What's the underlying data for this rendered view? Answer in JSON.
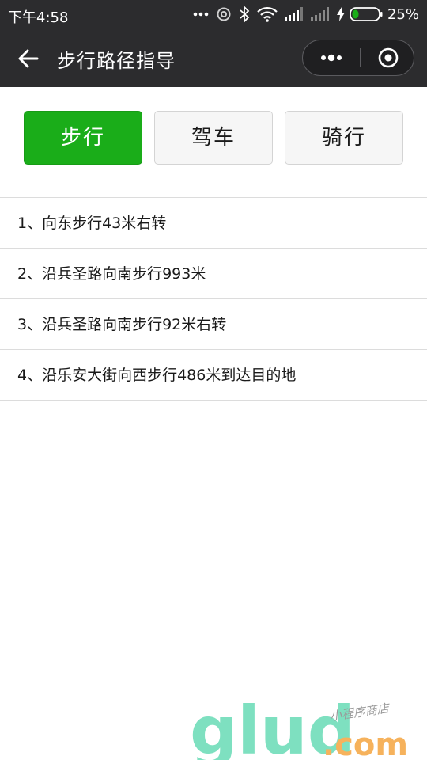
{
  "status_bar": {
    "time": "下午4:58",
    "battery_percent": "25%",
    "battery_level": 0.25,
    "icons": [
      "more-dots-icon",
      "signal-loop-icon",
      "bluetooth-icon",
      "wifi-icon",
      "cell-signal-icon",
      "cell-signal-icon",
      "charging-bolt-icon",
      "battery-icon"
    ]
  },
  "nav": {
    "title": "步行路径指导",
    "back_icon": "arrow-left-icon",
    "capsule_icons": [
      "more-dots-icon",
      "target-circle-icon"
    ]
  },
  "modes": {
    "walk": "步行",
    "drive": "驾车",
    "ride": "骑行",
    "active": "walk",
    "active_color": "#1aad19"
  },
  "steps": [
    "1、向东步行43米右转",
    "2、沿兵圣路向南步行993米",
    "3、沿兵圣路向南步行92米右转",
    "4、沿乐安大街向西步行486米到达目的地"
  ],
  "watermark": {
    "brand": "glud",
    "domain": ".com",
    "tagline": "小程序商店",
    "colors": [
      "#7ee0c0",
      "#f6d36a",
      "#f6a45c"
    ]
  }
}
